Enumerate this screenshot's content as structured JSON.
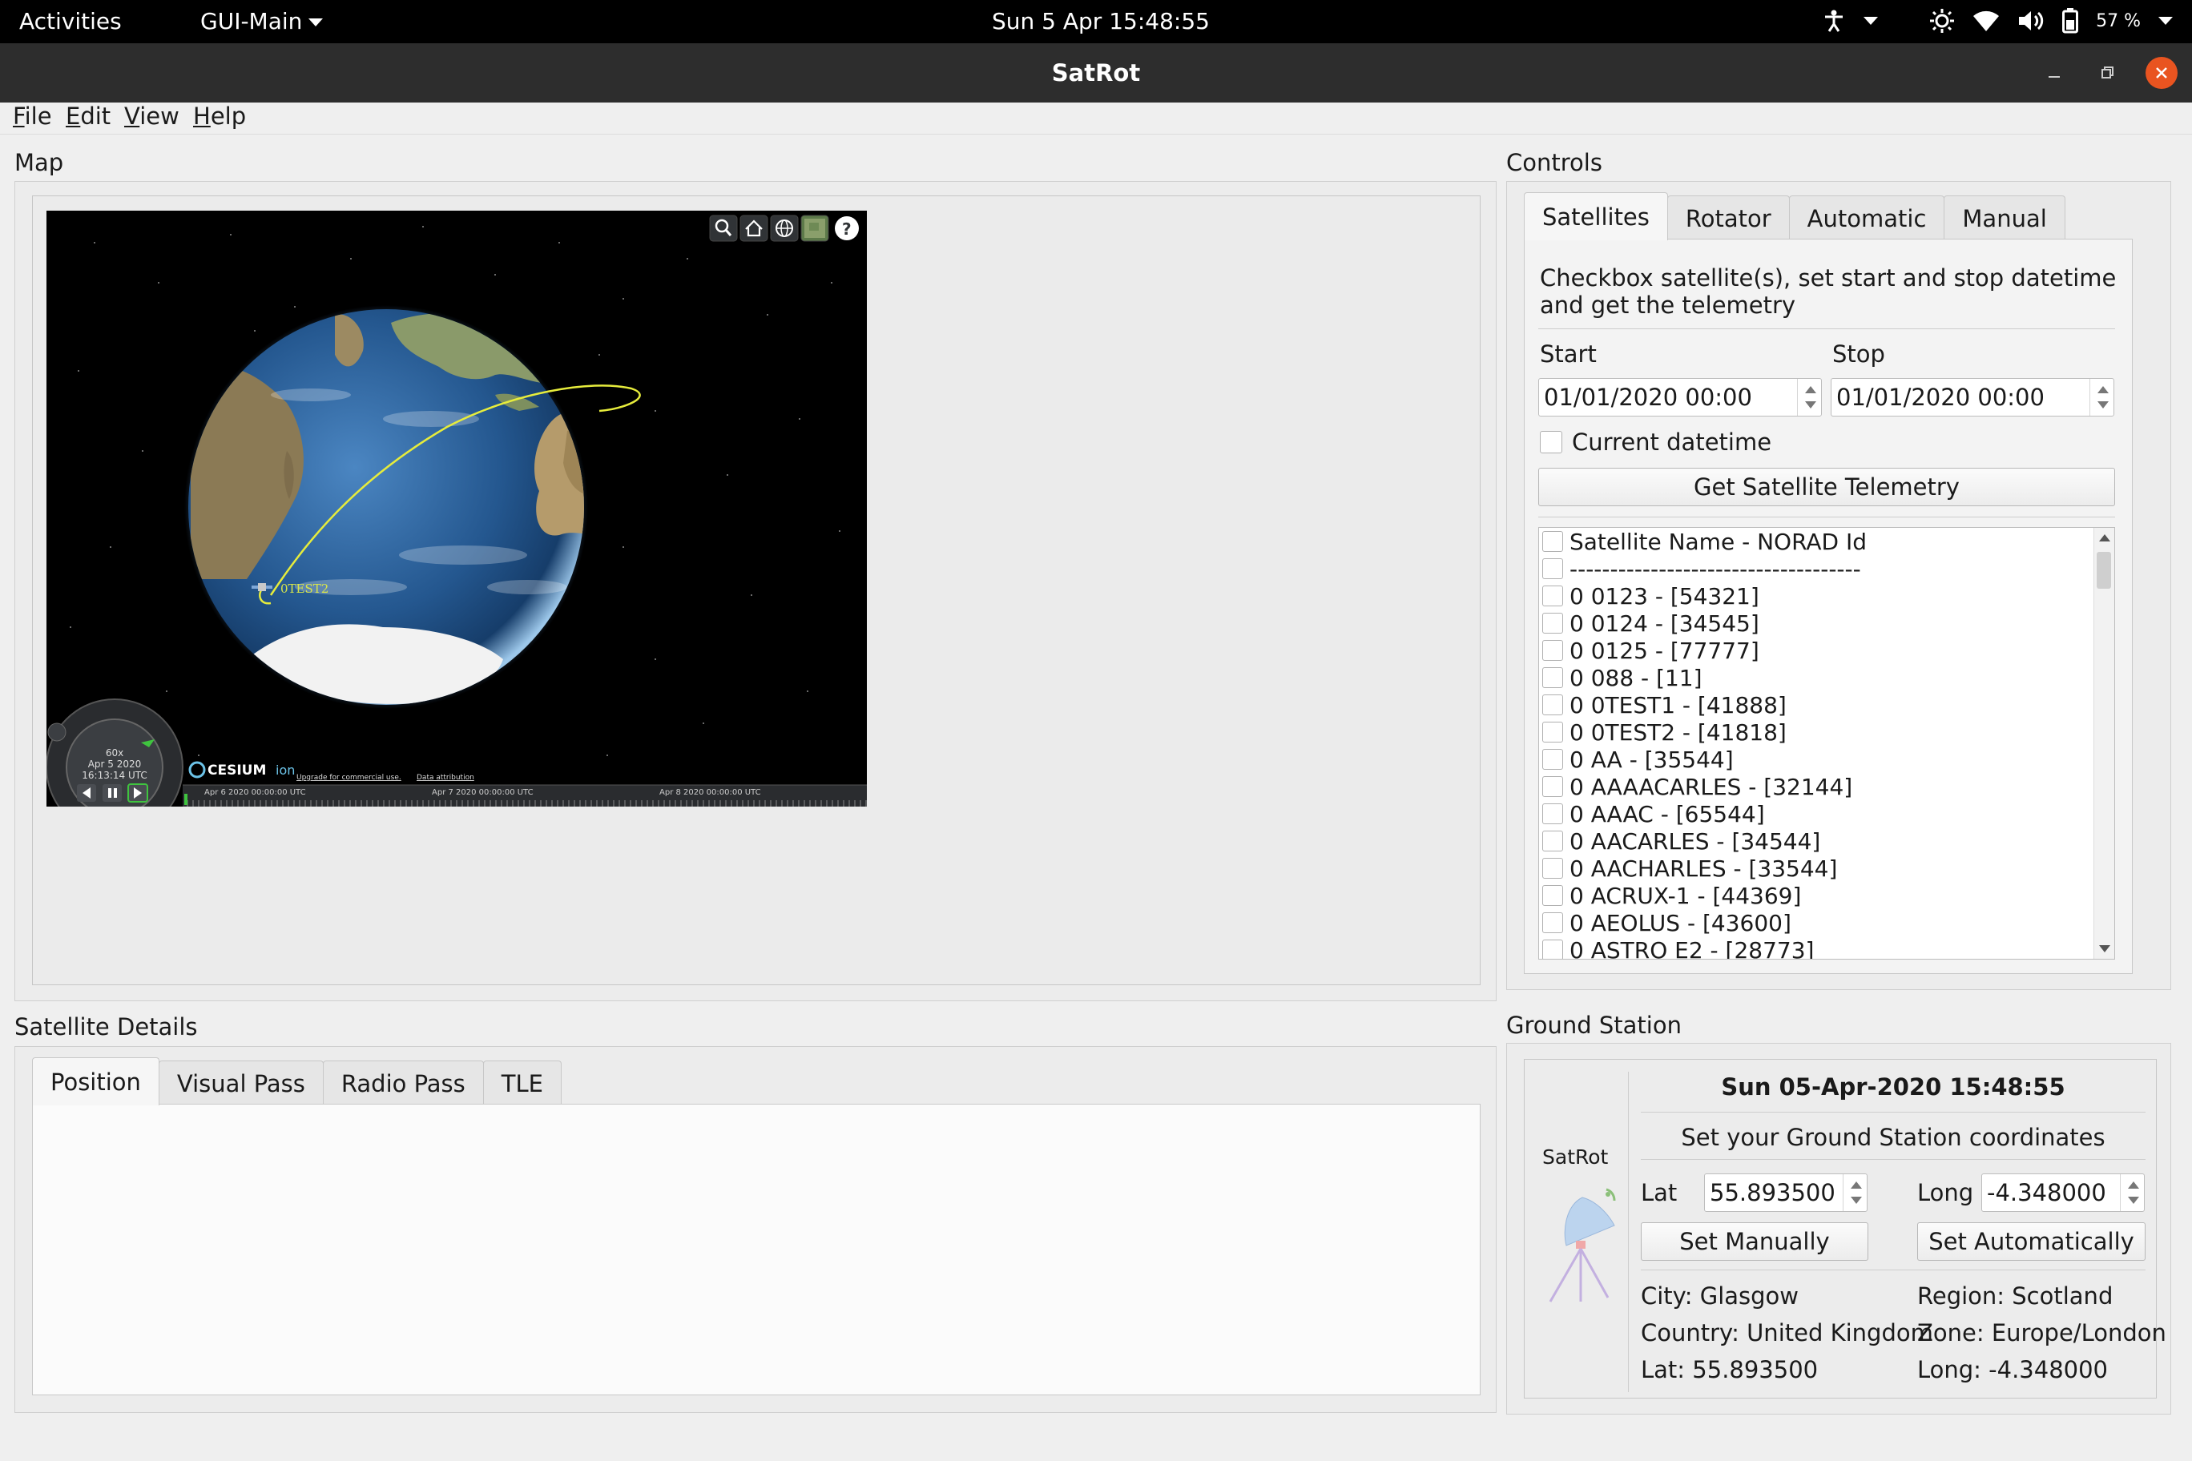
{
  "topbar": {
    "activities": "Activities",
    "app_menu": "GUI-Main",
    "clock": "Sun 5 Apr  15:48:55",
    "battery_pct": "57 %",
    "icons": [
      "accessibility-icon",
      "brightness-icon",
      "wifi-icon",
      "volume-icon",
      "battery-icon"
    ]
  },
  "window": {
    "title": "SatRot",
    "close_color": "#e95420"
  },
  "menubar": {
    "file": {
      "m": "F",
      "rest": "ile"
    },
    "edit": {
      "m": "E",
      "rest": "dit"
    },
    "view": {
      "m": "V",
      "rest": "iew"
    },
    "help": {
      "m": "H",
      "rest": "elp"
    }
  },
  "map": {
    "group_title": "Map",
    "sat_label": "0TEST2",
    "clock_speed": "60x",
    "clock_date": "Apr 5 2020",
    "clock_time": "16:13:14 UTC",
    "brand": "CESIUM",
    "brand_suffix": "ion",
    "link_upgrade": "Upgrade for commercial use.",
    "link_attribution": "Data attribution",
    "timeline_ticks": [
      "Apr 6 2020 00:00:00 UTC",
      "Apr 7 2020 00:00:00 UTC",
      "Apr 8 2020 00:00:00 UTC"
    ],
    "toolbar_icons": [
      "search-icon",
      "home-icon",
      "globe-icon",
      "imagery-icon",
      "help-icon"
    ]
  },
  "controls": {
    "group_title": "Controls",
    "tabs": [
      "Satellites",
      "Rotator",
      "Automatic",
      "Manual"
    ],
    "active_tab": "Satellites",
    "instructions": "Checkbox satellite(s), set start and stop datetime and get the telemetry",
    "start_label": "Start",
    "stop_label": "Stop",
    "start_value": "01/01/2020 00:00",
    "stop_value": "01/01/2020 00:00",
    "current_datetime_label": "Current datetime",
    "get_telemetry_button": "Get Satellite Telemetry",
    "satellites": [
      "Satellite Name - NORAD Id",
      "------------------------------------",
      "0 0123 - [54321]",
      "0 0124 - [34545]",
      "0 0125 - [77777]",
      "0 088 - [11]",
      "0 0TEST1 - [41888]",
      "0 0TEST2 - [41818]",
      "0 AA - [35544]",
      "0 AAAACARLES - [32144]",
      "0 AAAC - [65544]",
      "0 AACARLES - [34544]",
      "0 AACHARLES - [33544]",
      "0 ACRUX-1 - [44369]",
      "0 AEOLUS - [43600]",
      "0 ASTRO E2 - [28773]"
    ]
  },
  "details": {
    "group_title": "Satellite Details",
    "tabs": [
      "Position",
      "Visual Pass",
      "Radio Pass",
      "TLE"
    ],
    "active_tab": "Position"
  },
  "ground": {
    "group_title": "Ground Station",
    "logo_text": "SatRot",
    "datetime": "Sun 05-Apr-2020 15:48:55",
    "set_coords_label": "Set your Ground Station coordinates",
    "lat_label": "Lat",
    "lat_value": "55.893500",
    "long_label": "Long",
    "long_value": "-4.348000",
    "set_manually_button": "Set Manually",
    "set_automatically_button": "Set Automatically",
    "city": "City: Glasgow",
    "region": "Region: Scotland",
    "country": "Country: United Kingdom",
    "zone": "Zone: Europe/London",
    "lat_info": "Lat: 55.893500",
    "long_info": "Long: -4.348000"
  }
}
